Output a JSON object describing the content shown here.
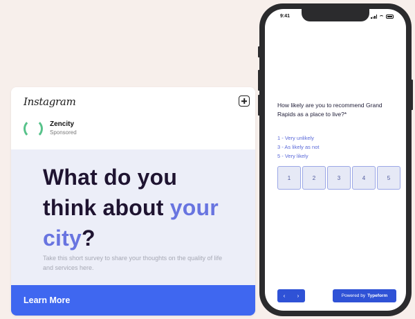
{
  "instagram_ad": {
    "platform": "Instagram",
    "account_name": "Zencity",
    "account_label": "Sponsored",
    "headline_part1": "What do you",
    "headline_part2": "think about",
    "headline_accent1": "your",
    "headline_accent2": "city",
    "headline_end": "?",
    "subtext": "Take this short survey to share your thoughts on the quality of life and services here.",
    "cta_label": "Learn More"
  },
  "phone": {
    "status_time": "9:41",
    "survey": {
      "question": "How likely are you to recommend Grand Rapids as a place to live?*",
      "legend": [
        "1 - Very unlikely",
        "3 - As likely as not",
        "5 - Very likely"
      ],
      "scale_options": [
        "1",
        "2",
        "3",
        "4",
        "5"
      ],
      "nav_prev": "‹",
      "nav_next": "›",
      "powered_by_prefix": "Powered by",
      "powered_by_brand": "Typeform"
    }
  },
  "colors": {
    "background": "#f7efeb",
    "headline": "#1f1431",
    "accent": "#6874e0",
    "cta_blue": "#3f67f0",
    "typeform_blue": "#2f52d6"
  }
}
